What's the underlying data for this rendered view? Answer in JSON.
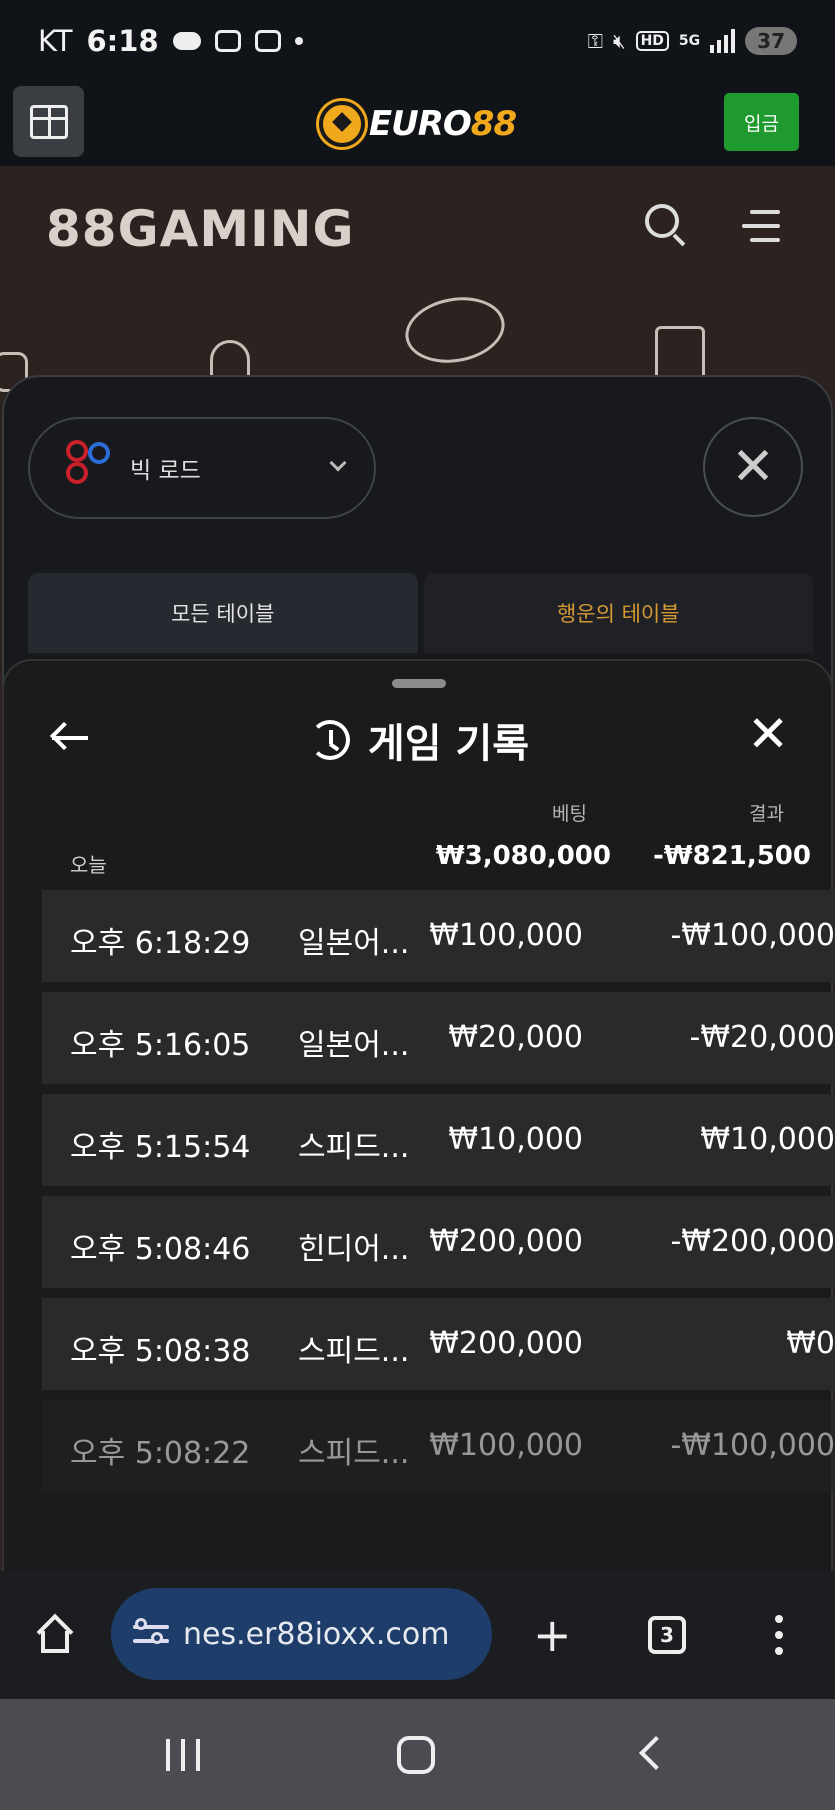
{
  "status_bar": {
    "carrier": "KT",
    "time": "6:18",
    "battery": "37",
    "network": "5G",
    "hd": "HD"
  },
  "site_header": {
    "logo_text_a": "EURO",
    "logo_text_b": "88",
    "deposit_label": "입금"
  },
  "game_site": {
    "logo": "88GAMING"
  },
  "lobby": {
    "road_selector": "빅 로드",
    "tabs": [
      "모든 테이블",
      "행운의 테이블"
    ]
  },
  "history": {
    "title": "게임 기록",
    "col_bet": "베팅",
    "col_result": "결과",
    "today_label": "오늘",
    "total_bet": "₩3,080,000",
    "total_result": "-₩821,500",
    "rows": [
      {
        "time": "오후 6:18:29",
        "game": "일본어...",
        "bet": "₩100,000",
        "result": "-₩100,000"
      },
      {
        "time": "오후 5:16:05",
        "game": "일본어...",
        "bet": "₩20,000",
        "result": "-₩20,000"
      },
      {
        "time": "오후 5:15:54",
        "game": "스피드...",
        "bet": "₩10,000",
        "result": "₩10,000"
      },
      {
        "time": "오후 5:08:46",
        "game": "힌디어...",
        "bet": "₩200,000",
        "result": "-₩200,000"
      },
      {
        "time": "오후 5:08:38",
        "game": "스피드...",
        "bet": "₩200,000",
        "result": "₩0"
      },
      {
        "time": "오후 5:08:22",
        "game": "스피드...",
        "bet": "₩100,000",
        "result": "-₩100,000"
      }
    ]
  },
  "browser": {
    "url": "nes.er88ioxx.com",
    "tab_count": "3"
  },
  "colors": {
    "accent_gold": "#f0a81c",
    "deposit_green": "#1f9a2f",
    "lucky_tab": "#d59a35",
    "url_pill": "#1e3d6a"
  }
}
